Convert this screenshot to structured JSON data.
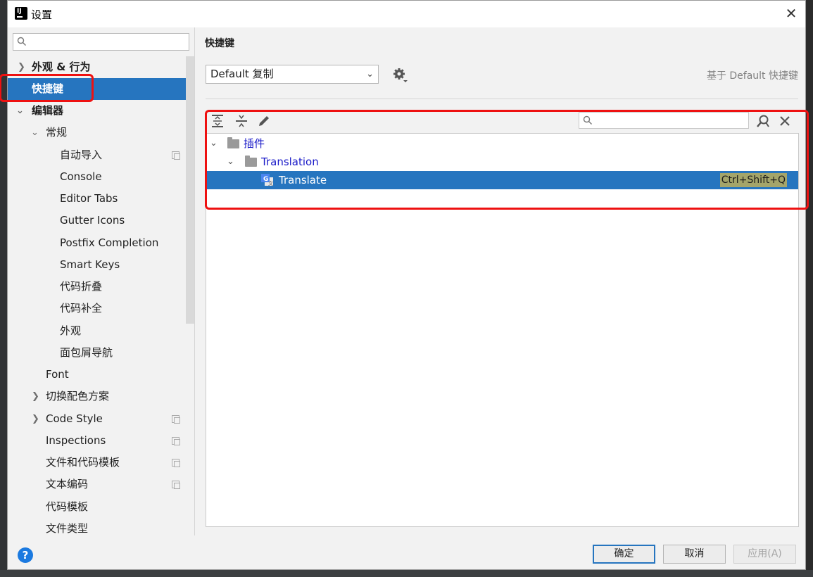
{
  "window": {
    "title": "设置"
  },
  "search": {
    "placeholder": ""
  },
  "sidebar": {
    "items": [
      {
        "label": "外观 & 行为"
      },
      {
        "label": "快捷键"
      },
      {
        "label": "编辑器"
      },
      {
        "label": "常规"
      },
      {
        "label": "自动导入"
      },
      {
        "label": "Console"
      },
      {
        "label": "Editor Tabs"
      },
      {
        "label": "Gutter Icons"
      },
      {
        "label": "Postfix Completion"
      },
      {
        "label": "Smart Keys"
      },
      {
        "label": "代码折叠"
      },
      {
        "label": "代码补全"
      },
      {
        "label": "外观"
      },
      {
        "label": "面包屑导航"
      },
      {
        "label": "Font"
      },
      {
        "label": "切换配色方案"
      },
      {
        "label": "Code Style"
      },
      {
        "label": "Inspections"
      },
      {
        "label": "文件和代码模板"
      },
      {
        "label": "文本编码"
      },
      {
        "label": "代码模板"
      },
      {
        "label": "文件类型"
      }
    ]
  },
  "main": {
    "title": "快捷键",
    "keymap": "Default 复制",
    "based_on": "基于 Default 快捷键",
    "filter": {
      "placeholder": ""
    },
    "tree": [
      {
        "label": "插件"
      },
      {
        "label": "Translation"
      },
      {
        "label": "Translate",
        "shortcut": "Ctrl+Shift+Q"
      }
    ]
  },
  "buttons": {
    "ok": "确定",
    "cancel": "取消",
    "apply": "应用(A)",
    "help": "?"
  },
  "colors": {
    "selection": "#2675bf",
    "highlight_box": "#e11111",
    "shortcut_bg": "#a4a56a",
    "plugin_text": "#1a1ac8"
  }
}
